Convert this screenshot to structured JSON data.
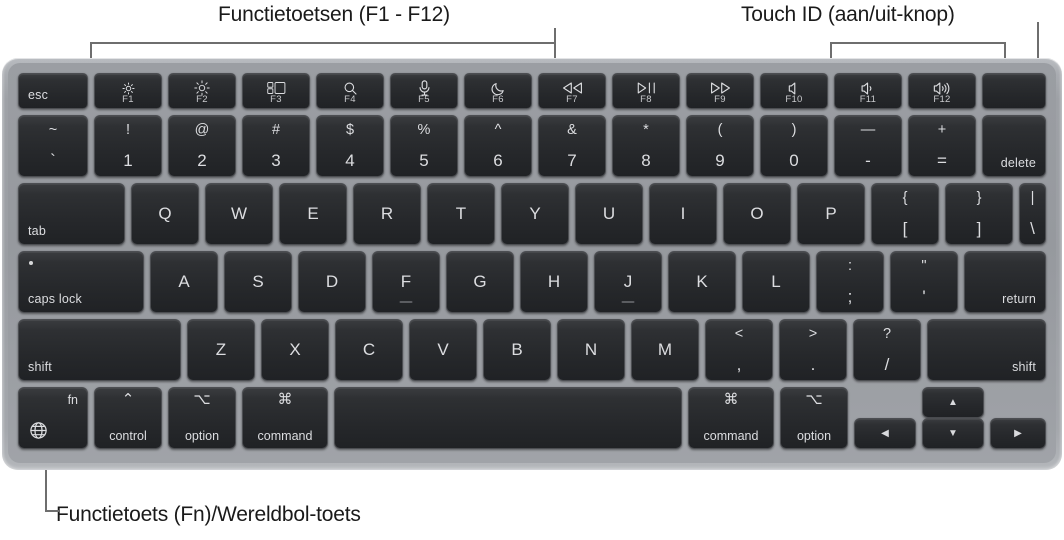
{
  "callouts": {
    "function_keys": "Functietoetsen (F1 - F12)",
    "touch_id": "Touch ID (aan/uit-knop)",
    "fn_globe": "Functietoets (Fn)/Wereldbol-toets"
  },
  "colors": {
    "page_background": "#ffffff",
    "chassis": "#9b9ea3",
    "key_face": "#2a2c2f",
    "key_text": "#dcdde0",
    "leader_line": "#6e6e6e",
    "label_text": "#1a1a1a"
  },
  "keyboard": {
    "function_row": [
      {
        "name": "esc",
        "label": "esc",
        "f": "",
        "icon": ""
      },
      {
        "name": "f1",
        "label": "",
        "f": "F1",
        "icon": "brightness-down-icon"
      },
      {
        "name": "f2",
        "label": "",
        "f": "F2",
        "icon": "brightness-up-icon"
      },
      {
        "name": "f3",
        "label": "",
        "f": "F3",
        "icon": "stage-manager-icon"
      },
      {
        "name": "f4",
        "label": "",
        "f": "F4",
        "icon": "spotlight-search-icon"
      },
      {
        "name": "f5",
        "label": "",
        "f": "F5",
        "icon": "dictation-mic-icon"
      },
      {
        "name": "f6",
        "label": "",
        "f": "F6",
        "icon": "do-not-disturb-moon-icon"
      },
      {
        "name": "f7",
        "label": "",
        "f": "F7",
        "icon": "rewind-icon"
      },
      {
        "name": "f8",
        "label": "",
        "f": "F8",
        "icon": "play-pause-icon"
      },
      {
        "name": "f9",
        "label": "",
        "f": "F9",
        "icon": "fast-forward-icon"
      },
      {
        "name": "f10",
        "label": "",
        "f": "F10",
        "icon": "mute-icon"
      },
      {
        "name": "f11",
        "label": "",
        "f": "F11",
        "icon": "volume-down-icon"
      },
      {
        "name": "f12",
        "label": "",
        "f": "F12",
        "icon": "volume-up-icon"
      },
      {
        "name": "touch-id",
        "label": "",
        "f": "",
        "icon": ""
      }
    ],
    "number_row": [
      {
        "name": "grave",
        "top": "~",
        "bottom": "`"
      },
      {
        "name": "1",
        "top": "!",
        "bottom": "1"
      },
      {
        "name": "2",
        "top": "@",
        "bottom": "2"
      },
      {
        "name": "3",
        "top": "#",
        "bottom": "3"
      },
      {
        "name": "4",
        "top": "$",
        "bottom": "4"
      },
      {
        "name": "5",
        "top": "%",
        "bottom": "5"
      },
      {
        "name": "6",
        "top": "^",
        "bottom": "6"
      },
      {
        "name": "7",
        "top": "&",
        "bottom": "7"
      },
      {
        "name": "8",
        "top": "*",
        "bottom": "8"
      },
      {
        "name": "9",
        "top": "(",
        "bottom": "9"
      },
      {
        "name": "0",
        "top": ")",
        "bottom": "0"
      },
      {
        "name": "minus",
        "top": "—",
        "bottom": "-"
      },
      {
        "name": "equal",
        "top": "+",
        "bottom": "="
      },
      {
        "name": "delete",
        "label": "delete"
      }
    ],
    "qwerty_row": [
      {
        "name": "tab",
        "label": "tab"
      },
      {
        "name": "q",
        "letter": "Q"
      },
      {
        "name": "w",
        "letter": "W"
      },
      {
        "name": "e",
        "letter": "E"
      },
      {
        "name": "r",
        "letter": "R"
      },
      {
        "name": "t",
        "letter": "T"
      },
      {
        "name": "y",
        "letter": "Y"
      },
      {
        "name": "u",
        "letter": "U"
      },
      {
        "name": "i",
        "letter": "I"
      },
      {
        "name": "o",
        "letter": "O"
      },
      {
        "name": "p",
        "letter": "P"
      },
      {
        "name": "bracket-left",
        "top": "{",
        "bottom": "["
      },
      {
        "name": "bracket-right",
        "top": "}",
        "bottom": "]"
      },
      {
        "name": "backslash",
        "top": "|",
        "bottom": "\\"
      }
    ],
    "home_row": [
      {
        "name": "caps-lock",
        "label": "caps lock"
      },
      {
        "name": "a",
        "letter": "A"
      },
      {
        "name": "s",
        "letter": "S"
      },
      {
        "name": "d",
        "letter": "D"
      },
      {
        "name": "f",
        "letter": "F",
        "bump": true
      },
      {
        "name": "g",
        "letter": "G"
      },
      {
        "name": "h",
        "letter": "H"
      },
      {
        "name": "j",
        "letter": "J",
        "bump": true
      },
      {
        "name": "k",
        "letter": "K"
      },
      {
        "name": "l",
        "letter": "L"
      },
      {
        "name": "semicolon",
        "top": ":",
        "bottom": ";"
      },
      {
        "name": "quote",
        "top": "\"",
        "bottom": "'"
      },
      {
        "name": "return",
        "label": "return"
      }
    ],
    "shift_row": [
      {
        "name": "shift-left",
        "label": "shift"
      },
      {
        "name": "z",
        "letter": "Z"
      },
      {
        "name": "x",
        "letter": "X"
      },
      {
        "name": "c",
        "letter": "C"
      },
      {
        "name": "v",
        "letter": "V"
      },
      {
        "name": "b",
        "letter": "B"
      },
      {
        "name": "n",
        "letter": "N"
      },
      {
        "name": "m",
        "letter": "M"
      },
      {
        "name": "comma",
        "top": "<",
        "bottom": ","
      },
      {
        "name": "period",
        "top": ">",
        "bottom": "."
      },
      {
        "name": "slash",
        "top": "?",
        "bottom": "/"
      },
      {
        "name": "shift-right",
        "label": "shift"
      }
    ],
    "bottom_row": [
      {
        "name": "fn",
        "corner": "fn",
        "icon": "globe-icon"
      },
      {
        "name": "control",
        "symbol": "⌃",
        "label": "control"
      },
      {
        "name": "option-left",
        "symbol": "⌥",
        "label": "option"
      },
      {
        "name": "command-left",
        "symbol": "⌘",
        "label": "command"
      },
      {
        "name": "space",
        "label": ""
      },
      {
        "name": "command-right",
        "symbol": "⌘",
        "label": "command"
      },
      {
        "name": "option-right",
        "symbol": "⌥",
        "label": "option"
      },
      {
        "name": "arrow-left",
        "glyph": "◀"
      },
      {
        "name": "arrow-up",
        "glyph": "▲"
      },
      {
        "name": "arrow-down",
        "glyph": "▼"
      },
      {
        "name": "arrow-right",
        "glyph": "▶"
      }
    ]
  }
}
